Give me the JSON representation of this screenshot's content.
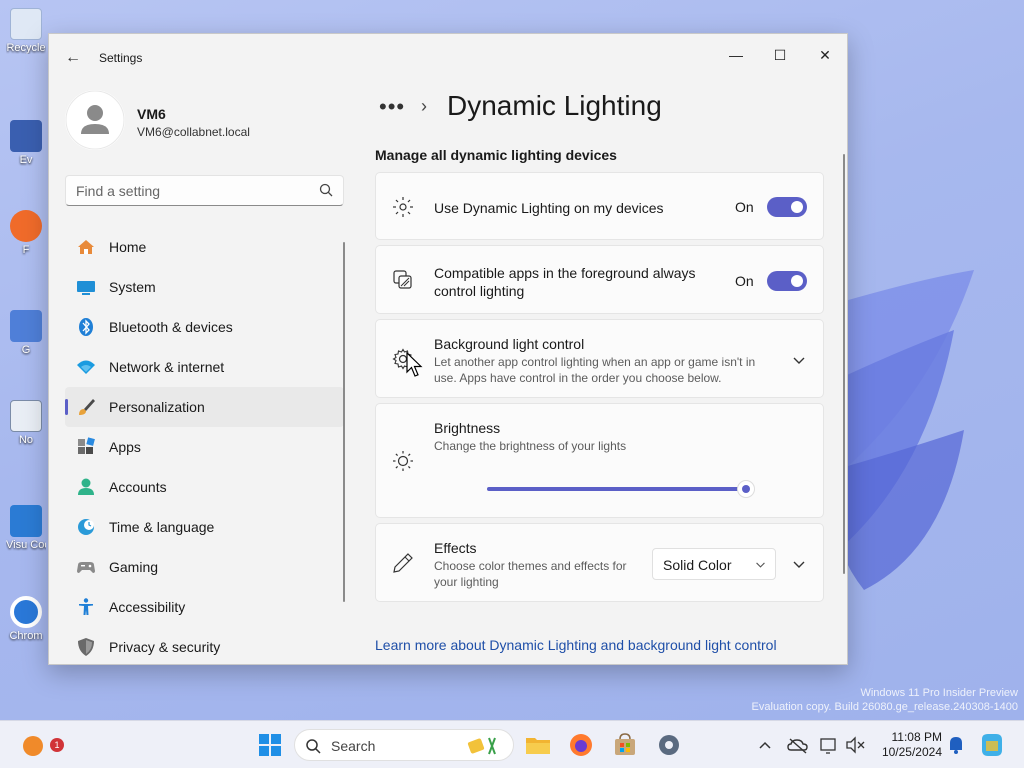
{
  "window": {
    "title": "Settings",
    "minimize": "—",
    "maximize": "☐",
    "close": "✕"
  },
  "user": {
    "name": "VM6",
    "email": "VM6@collabnet.local"
  },
  "search": {
    "placeholder": "Find a setting"
  },
  "nav": [
    {
      "label": "Home",
      "icon": "home-icon",
      "active": false
    },
    {
      "label": "System",
      "icon": "system-icon",
      "active": false
    },
    {
      "label": "Bluetooth & devices",
      "icon": "bluetooth-icon",
      "active": false
    },
    {
      "label": "Network & internet",
      "icon": "wifi-icon",
      "active": false
    },
    {
      "label": "Personalization",
      "icon": "brush-icon",
      "active": true
    },
    {
      "label": "Apps",
      "icon": "apps-icon",
      "active": false
    },
    {
      "label": "Accounts",
      "icon": "person-icon",
      "active": false
    },
    {
      "label": "Time & language",
      "icon": "globe-clock-icon",
      "active": false
    },
    {
      "label": "Gaming",
      "icon": "gamepad-icon",
      "active": false
    },
    {
      "label": "Accessibility",
      "icon": "accessibility-icon",
      "active": false
    },
    {
      "label": "Privacy & security",
      "icon": "shield-icon",
      "active": false
    }
  ],
  "breadcrumb": {
    "dots": "•••",
    "separator": "›",
    "title": "Dynamic Lighting"
  },
  "section": {
    "title": "Manage all dynamic lighting devices"
  },
  "settings": {
    "use_dynamic": {
      "title": "Use Dynamic Lighting on my devices",
      "state": "On",
      "on": true
    },
    "foreground": {
      "title": "Compatible apps in the foreground always control lighting",
      "state": "On",
      "on": true
    },
    "background": {
      "title": "Background light control",
      "desc": "Let another app control lighting when an app or game isn't in use. Apps have control in the order you choose below."
    },
    "brightness": {
      "title": "Brightness",
      "desc": "Change the brightness of your lights",
      "value_fraction": 1.0
    },
    "effects": {
      "title": "Effects",
      "desc": "Choose color themes and effects for your lighting",
      "selected": "Solid Color"
    }
  },
  "learn_more": "Learn more about Dynamic Lighting and background light control",
  "desktop": {
    "icons": [
      "Recycle",
      "Ev",
      "F",
      "G",
      "No",
      "Visu Cod",
      "Chrom"
    ],
    "watermark_line1": "Windows 11 Pro Insider Preview",
    "watermark_line2": "Evaluation copy. Build 26080.ge_release.240308-1400"
  },
  "taskbar": {
    "search_label": "Search",
    "time": "11:08 PM",
    "date": "10/25/2024",
    "badge": "1"
  },
  "colors": {
    "accent": "#5b5fc7",
    "link": "#1f4fa8",
    "window_bg": "#f3f3f3",
    "card_bg": "#fbfbfb"
  }
}
